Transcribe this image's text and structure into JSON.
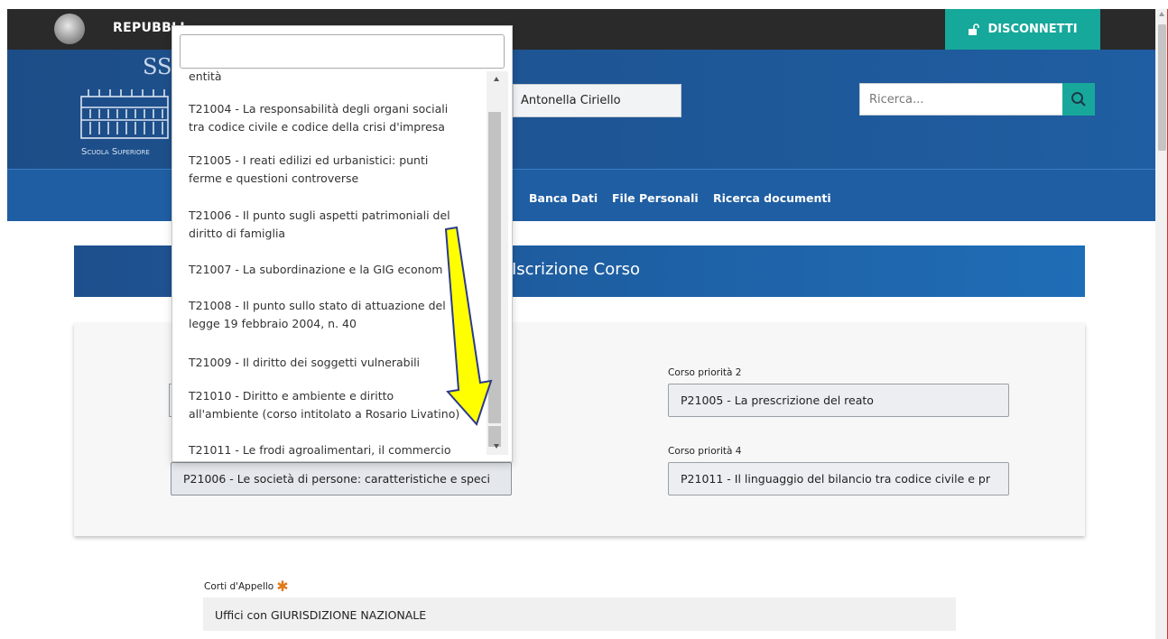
{
  "topbar": {
    "republic_label": "REPUBBLI",
    "logout_label": "DISCONNETTI",
    "background_color": "#2a2a2a",
    "logout_color": "#16a89a"
  },
  "header": {
    "logo_text": "SS",
    "logo_caption": "Scuola Superiore",
    "user_name": "Antonella  Ciriello",
    "search_placeholder": "Ricerca...",
    "search_icon": "search-icon"
  },
  "nav": {
    "items": [
      {
        "label": "Banca Dati"
      },
      {
        "label": "File Personali"
      },
      {
        "label": "Ricerca documenti"
      }
    ]
  },
  "page": {
    "title": "Iscrizione Corso"
  },
  "form": {
    "prio1_value": "P21006 - Le società di persone: caratteristiche e speci",
    "prio2_label": "Corso priorità 2",
    "prio2_value": "P21005 - La prescrizione del reato",
    "prio4_label": "Corso priorità 4",
    "prio4_value": "P21011 - Il linguaggio del bilancio tra codice civile e pr"
  },
  "corti": {
    "label": "Corti d'Appello",
    "value": "Uffici con GIURISDIZIONE NAZIONALE"
  },
  "dropdown": {
    "search_value": "",
    "options": [
      {
        "line1": "entità",
        "line2": ""
      },
      {
        "line1": "T21004 - La responsabilità degli organi sociali",
        "line2": "tra codice civile e codice della crisi d'impresa"
      },
      {
        "line1": "T21005 - I reati edilizi ed urbanistici: punti",
        "line2": "ferme e questioni controverse"
      },
      {
        "line1": "T21006 - Il punto sugli aspetti patrimoniali del",
        "line2": "diritto di famiglia"
      },
      {
        "line1": "T21007 - La subordinazione e la GIG econom",
        "line2": ""
      },
      {
        "line1": "T21008 - Il punto sullo stato di attuazione del",
        "line2": "legge 19 febbraio 2004, n. 40"
      },
      {
        "line1": "T21009 - Il diritto dei soggetti vulnerabili",
        "line2": ""
      },
      {
        "line1": "T21010 - Diritto e ambiente e diritto",
        "line2": "all'ambiente (corso intitolato a Rosario Livatino)"
      },
      {
        "line1": "T21011 - Le frodi agroalimentari, il commercio",
        "line2": ""
      }
    ]
  },
  "annotation": {
    "arrow_color": "#ffff00",
    "arrow_icon": "down-arrow-icon"
  }
}
